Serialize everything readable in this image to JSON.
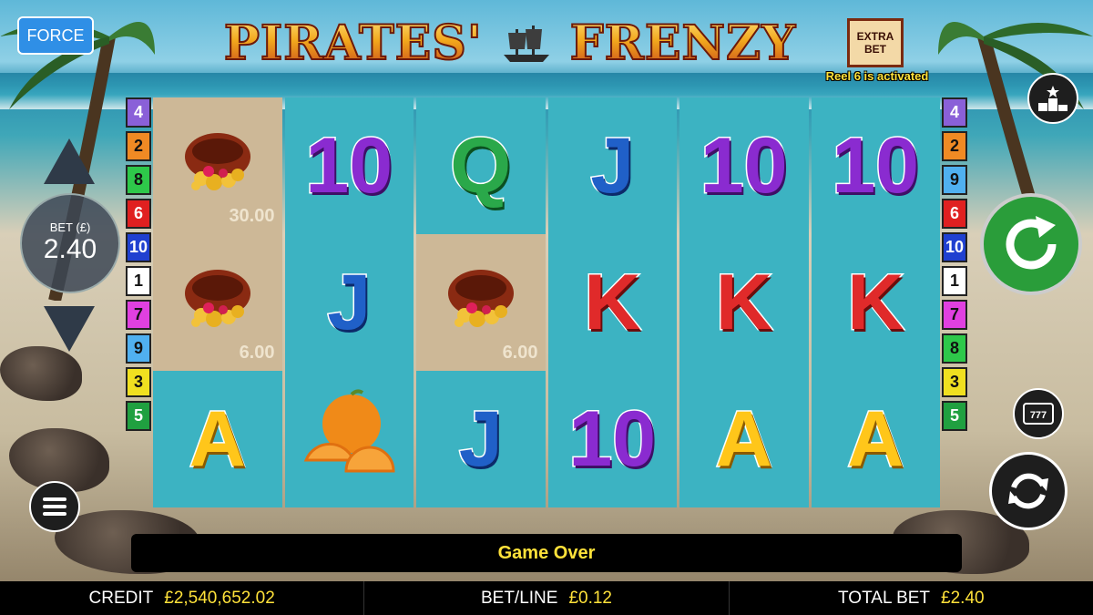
{
  "force_label": "FORCE",
  "title": {
    "word1": "PIRATES'",
    "word2": "FRENZY"
  },
  "extra_bet": {
    "line1": "EXTRA",
    "line2": "BET",
    "status": "Reel 6 is activated"
  },
  "bet": {
    "label": "BET (£)",
    "value": "2.40"
  },
  "message": "Game Over",
  "footer": {
    "credit_label": "CREDIT",
    "credit_value": "£2,540,652.02",
    "betline_label": "BET/LINE",
    "betline_value": "£0.12",
    "total_label": "TOTAL BET",
    "total_value": "£2.40"
  },
  "paylines_left": [
    {
      "n": "4",
      "color": "#8a60d8"
    },
    {
      "n": "2",
      "color": "#f08a24"
    },
    {
      "n": "8",
      "color": "#2ec84a"
    },
    {
      "n": "6",
      "color": "#e02020"
    },
    {
      "n": "10",
      "color": "#2040d0"
    },
    {
      "n": "1",
      "color": "#ffffff"
    },
    {
      "n": "7",
      "color": "#e040e0"
    },
    {
      "n": "9",
      "color": "#50b0f0"
    },
    {
      "n": "3",
      "color": "#f0e020"
    },
    {
      "n": "5",
      "color": "#20a040"
    }
  ],
  "paylines_right": [
    {
      "n": "4",
      "color": "#8a60d8"
    },
    {
      "n": "2",
      "color": "#f08a24"
    },
    {
      "n": "9",
      "color": "#50b0f0"
    },
    {
      "n": "6",
      "color": "#e02020"
    },
    {
      "n": "10",
      "color": "#2040d0"
    },
    {
      "n": "1",
      "color": "#ffffff"
    },
    {
      "n": "7",
      "color": "#e040e0"
    },
    {
      "n": "8",
      "color": "#2ec84a"
    },
    {
      "n": "3",
      "color": "#f0e020"
    },
    {
      "n": "5",
      "color": "#20a040"
    }
  ],
  "reels": [
    [
      {
        "sym": "treasure",
        "sand": true,
        "value": "30.00"
      },
      {
        "sym": "treasure",
        "sand": true,
        "value": "6.00"
      },
      {
        "sym": "A"
      }
    ],
    [
      {
        "sym": "10"
      },
      {
        "sym": "J"
      },
      {
        "sym": "orange"
      }
    ],
    [
      {
        "sym": "Q"
      },
      {
        "sym": "treasure",
        "sand": true,
        "value": "6.00"
      },
      {
        "sym": "J"
      }
    ],
    [
      {
        "sym": "J"
      },
      {
        "sym": "K"
      },
      {
        "sym": "10"
      }
    ],
    [
      {
        "sym": "10"
      },
      {
        "sym": "K"
      },
      {
        "sym": "A"
      }
    ],
    [
      {
        "sym": "10"
      },
      {
        "sym": "K"
      },
      {
        "sym": "A"
      }
    ]
  ]
}
